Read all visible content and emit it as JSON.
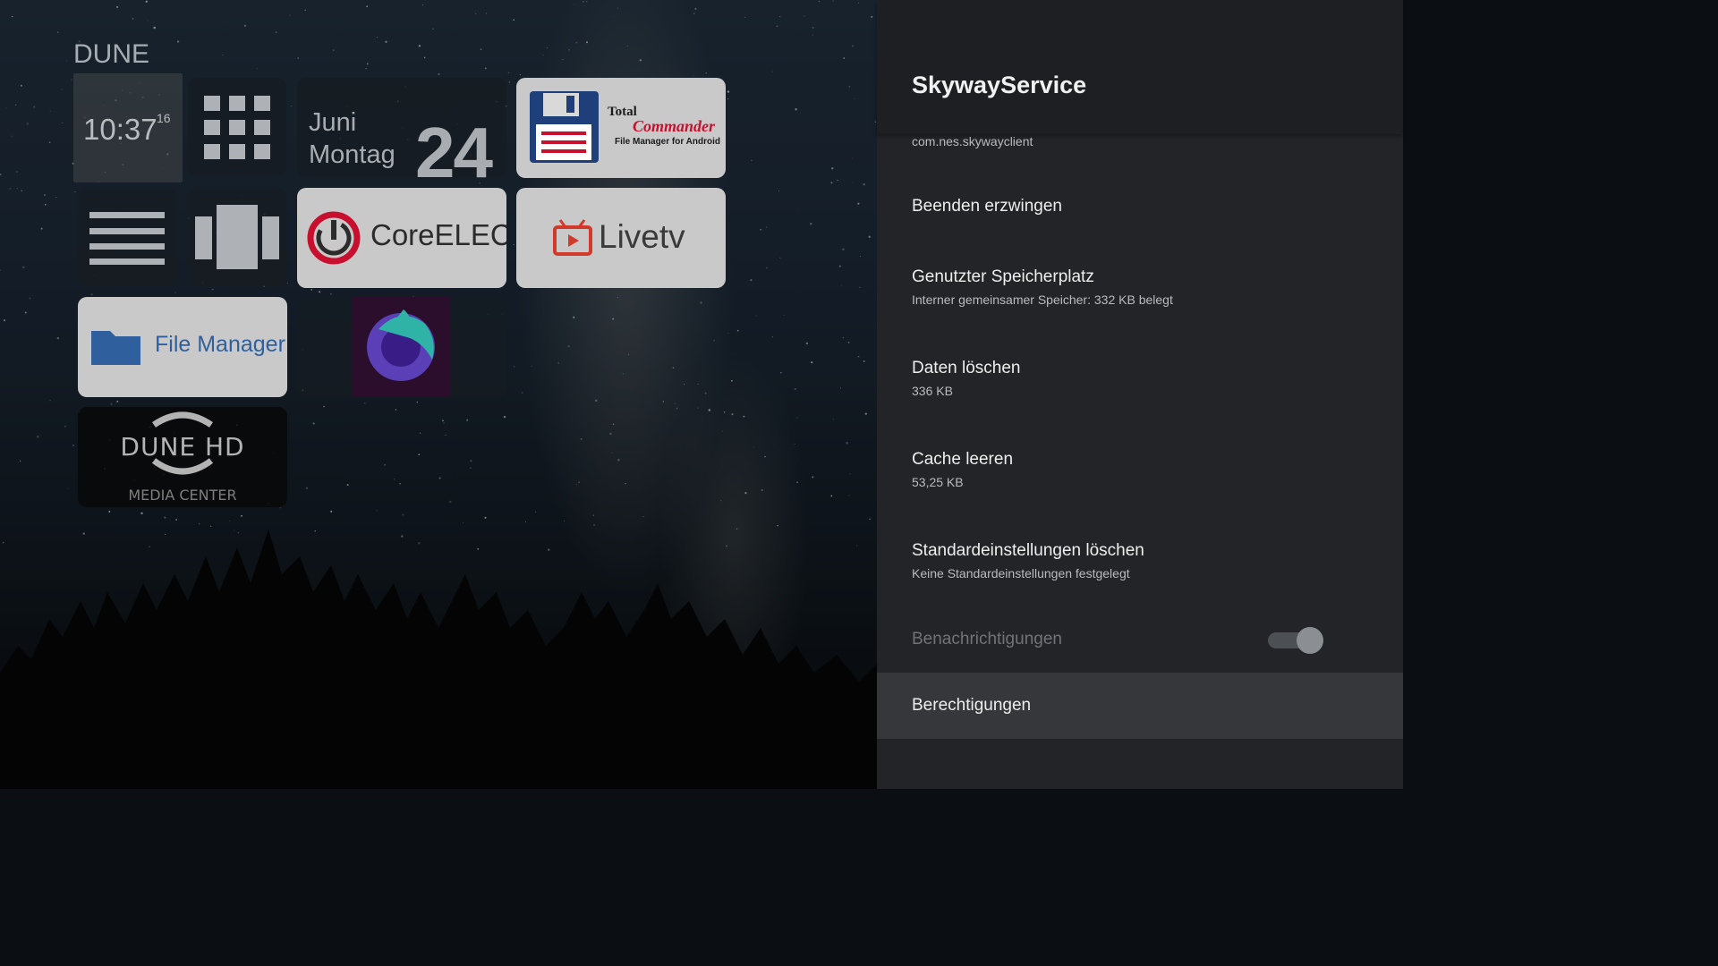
{
  "launcher": {
    "brand": "DUNE",
    "clock": {
      "time": "10:37",
      "seconds": "16"
    },
    "date": {
      "month": "Juni",
      "weekday": "Montag",
      "day": "24"
    },
    "tiles": {
      "total_commander": {
        "line1": "Total",
        "line2": "Commander",
        "line3": "File Manager for Android"
      },
      "coreelec": "CoreELEC",
      "livetv": "Livetv",
      "file_manager": "File Manager",
      "dune_hd": {
        "logo": "DUNE HD",
        "subtitle": "MEDIA CENTER"
      }
    }
  },
  "settings": {
    "app_name": "SkywayService",
    "package": "com.nes.skywayclient",
    "items": [
      {
        "title": "Beenden erzwingen",
        "subtitle": ""
      },
      {
        "title": "Genutzter Speicherplatz",
        "subtitle": "Interner gemeinsamer Speicher: 332 KB belegt"
      },
      {
        "title": "Daten löschen",
        "subtitle": "336 KB"
      },
      {
        "title": "Cache leeren",
        "subtitle": "53,25 KB"
      },
      {
        "title": "Standardeinstellungen löschen",
        "subtitle": "Keine Standardeinstellungen festgelegt"
      },
      {
        "title": "Benachrichtigungen",
        "subtitle": "",
        "toggle": true,
        "enabled": false
      },
      {
        "title": "Berechtigungen",
        "subtitle": "",
        "focused": true
      }
    ]
  },
  "colors": {
    "panel_bg": "#222427",
    "header_bg": "#1d1f22",
    "focus_bg": "#35373a",
    "coreelec_red": "#c8102e",
    "livetv_red": "#d13a2a",
    "file_manager_blue": "#2f5f9d"
  }
}
